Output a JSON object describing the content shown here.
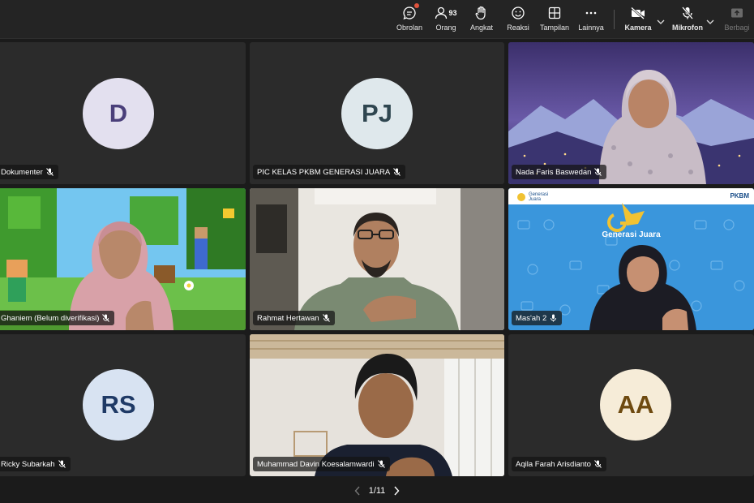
{
  "toolbar": {
    "chat_label": "Obrolan",
    "people_label": "Orang",
    "people_count": "93",
    "raise_label": "Angkat",
    "react_label": "Reaksi",
    "view_label": "Tampilan",
    "more_label": "Lainnya",
    "camera_label": "Kamera",
    "mic_label": "Mikrofon",
    "share_label": "Berbagi"
  },
  "tiles": [
    {
      "name": "Dokumenter",
      "initials": "D",
      "avatar_color": "#e3e0ef",
      "initial_color": "#4a3f7a"
    },
    {
      "name": "PIC KELAS PKBM GENERASI JUARA",
      "initials": "PJ",
      "avatar_color": "#dfe8ec",
      "initial_color": "#2f4650"
    },
    {
      "name": "Nada Faris Baswedan"
    },
    {
      "name": "Ghaniem (Belum diverifikasi)"
    },
    {
      "name": "Rahmat Hertawan"
    },
    {
      "name": "Mas'ah 2"
    },
    {
      "name": "Ricky Subarkah",
      "initials": "RS",
      "avatar_color": "#d8e3f2",
      "initial_color": "#1f3a66"
    },
    {
      "name": "Muhammad Davin Koesalamwardi"
    },
    {
      "name": "Aqila Farah Arisdianto",
      "initials": "AA",
      "avatar_color": "#f6ecd8",
      "initial_color": "#6e4a10"
    }
  ],
  "background_text": {
    "brand_small": "Generasi Juara",
    "brand_corner": "PKBM",
    "brand_title": "Generasi Juara"
  },
  "pager": {
    "label": "1/11"
  }
}
